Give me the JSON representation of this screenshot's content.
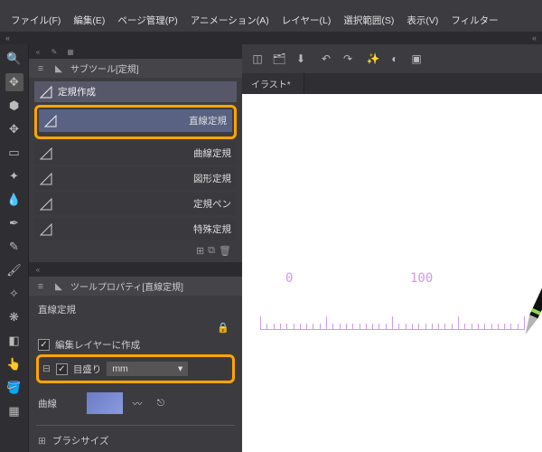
{
  "menu": {
    "file": "ファイル(F)",
    "edit": "編集(E)",
    "page": "ページ管理(P)",
    "anim": "アニメーション(A)",
    "layer": "レイヤー(L)",
    "sel": "選択範囲(S)",
    "view": "表示(V)",
    "filter": "フィルター"
  },
  "subtool": {
    "header": "サブツール[定規]",
    "group": "定規作成",
    "items": {
      "line": "直線定規",
      "curve": "曲線定規",
      "shape": "図形定規",
      "pen": "定規ペン",
      "special": "特殊定規"
    }
  },
  "prop": {
    "header": "ツールプロパティ[直線定規]",
    "sub": "直線定規",
    "edit_layer": "編集レイヤーに作成",
    "scale": "目盛り",
    "unit": "mm",
    "curve": "曲線",
    "brush": "ブラシサイズ"
  },
  "canvas": {
    "tab": "イラスト*",
    "scale0": "0",
    "scale100": "100"
  }
}
